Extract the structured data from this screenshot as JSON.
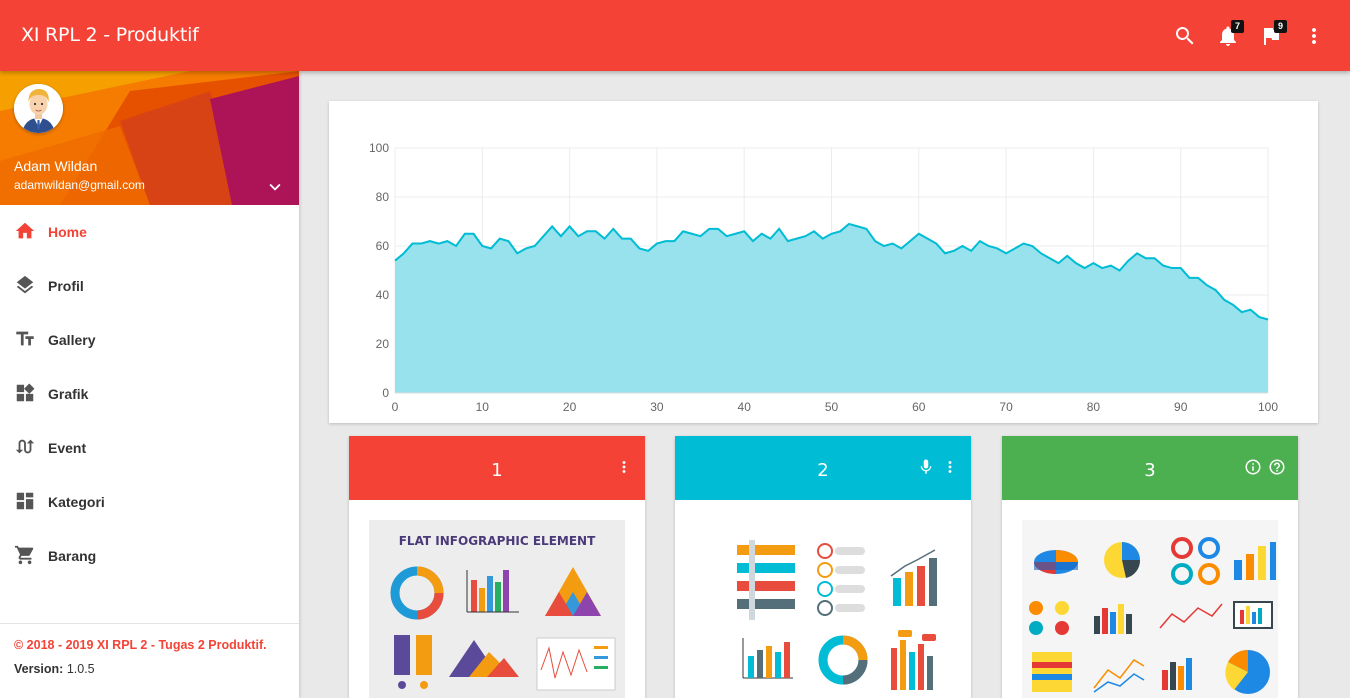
{
  "app": {
    "title": "XI RPL 2 - Produktif"
  },
  "topbar": {
    "icons": [
      "search-icon",
      "bell-icon",
      "flag-icon",
      "more-vert-icon"
    ],
    "notifications_count": "7",
    "flags_count": "9"
  },
  "user": {
    "name": "Adam Wildan",
    "email": "adamwildan@gmail.com"
  },
  "menu": {
    "items": [
      {
        "label": "Home",
        "icon": "home-icon",
        "active": true
      },
      {
        "label": "Profil",
        "icon": "layers-icon"
      },
      {
        "label": "Gallery",
        "icon": "text-fields-icon"
      },
      {
        "label": "Grafik",
        "icon": "widgets-icon"
      },
      {
        "label": "Event",
        "icon": "swap-calls-icon"
      },
      {
        "label": "Kategori",
        "icon": "view-quilt-icon"
      },
      {
        "label": "Barang",
        "icon": "shopping-cart-icon"
      }
    ]
  },
  "footer": {
    "copyright": "© 2018 - 2019 XI RPL 2 - Tugas 2 Produktif.",
    "version_label": "Version:",
    "version_value": "1.0.5"
  },
  "chart_data": {
    "type": "area",
    "x_ticks": [
      "0",
      "10",
      "20",
      "30",
      "40",
      "50",
      "60",
      "70",
      "80",
      "90",
      "100"
    ],
    "y_ticks": [
      "0",
      "20",
      "40",
      "60",
      "80",
      "100"
    ],
    "xlim": [
      0,
      100
    ],
    "ylim": [
      0,
      100
    ],
    "grid": true,
    "color": "#00bcd4",
    "fill_color": "#98e2ed",
    "values": [
      54,
      57,
      61,
      61,
      62,
      61,
      62,
      60,
      65,
      65,
      60,
      59,
      63,
      62,
      57,
      59,
      60,
      64,
      68,
      64,
      68,
      64,
      66,
      66,
      63,
      67,
      63,
      63,
      59,
      58,
      61,
      62,
      62,
      66,
      65,
      64,
      67,
      67,
      64,
      65,
      66,
      62,
      65,
      63,
      67,
      62,
      63,
      64,
      66,
      63,
      65,
      66,
      69,
      68,
      67,
      62,
      60,
      61,
      59,
      62,
      65,
      63,
      61,
      57,
      58,
      60,
      58,
      62,
      60,
      59,
      57,
      59,
      61,
      60,
      57,
      55,
      53,
      56,
      53,
      51,
      53,
      51,
      52,
      50,
      54,
      57,
      55,
      55,
      52,
      51,
      51,
      47,
      47,
      44,
      42,
      38,
      36,
      33,
      34,
      31,
      30
    ]
  },
  "cards": [
    {
      "title": "1",
      "color": "#f44336",
      "actions": [
        "more-vert-icon"
      ],
      "image_title": "FLAT INFOGRAPHIC ELEMENT"
    },
    {
      "title": "2",
      "color": "#00bcd4",
      "actions": [
        "mic-icon",
        "more-vert-icon"
      ]
    },
    {
      "title": "3",
      "color": "#4caf50",
      "actions": [
        "info-icon",
        "help-icon"
      ]
    }
  ]
}
